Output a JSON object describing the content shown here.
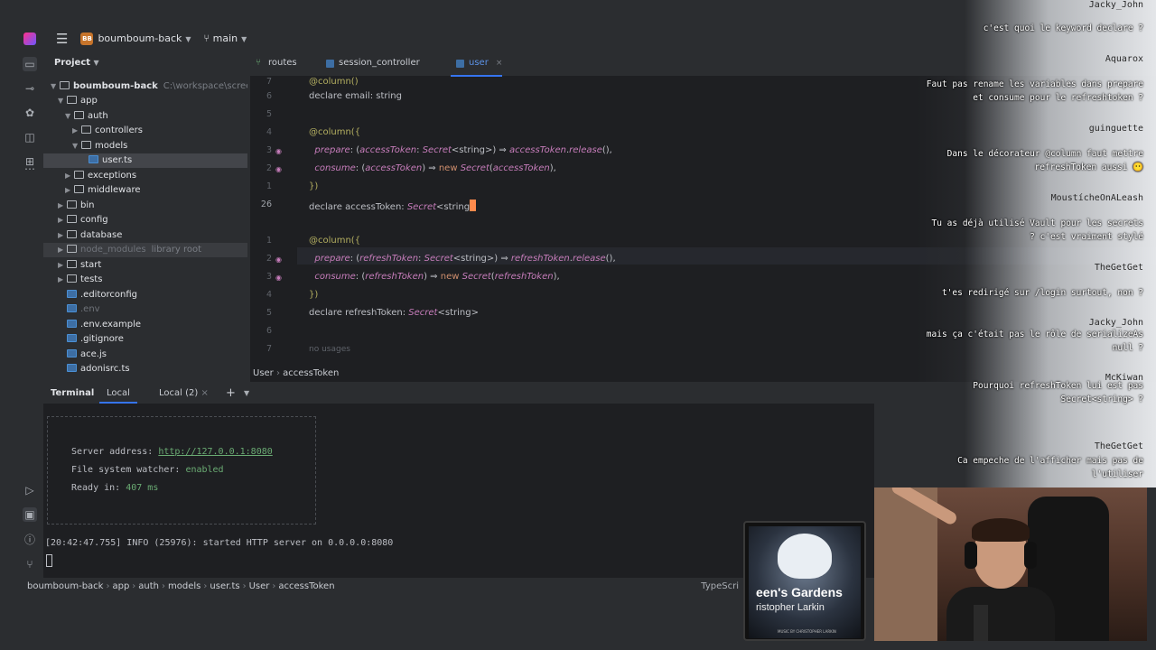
{
  "titlebar": {
    "project_badge": "BB",
    "project_name": "boumboum-back",
    "branch": "main"
  },
  "project_panel": {
    "title": "Project",
    "tree": [
      {
        "label": "boumboum-back",
        "path": "C:\\workspace\\screenca",
        "indent": 0
      },
      {
        "label": "app",
        "indent": 1
      },
      {
        "label": "auth",
        "indent": 2
      },
      {
        "label": "controllers",
        "indent": 3
      },
      {
        "label": "models",
        "indent": 3
      },
      {
        "label": "user.ts",
        "indent": 4
      },
      {
        "label": "exceptions",
        "indent": 2
      },
      {
        "label": "middleware",
        "indent": 2
      },
      {
        "label": "bin",
        "indent": 1
      },
      {
        "label": "config",
        "indent": 1
      },
      {
        "label": "database",
        "indent": 1
      },
      {
        "label": "node_modules",
        "path": "library root",
        "indent": 1
      },
      {
        "label": "start",
        "indent": 1
      },
      {
        "label": "tests",
        "indent": 1
      },
      {
        "label": ".editorconfig",
        "indent": 1
      },
      {
        "label": ".env",
        "indent": 1
      },
      {
        "label": ".env.example",
        "indent": 1
      },
      {
        "label": ".gitignore",
        "indent": 1
      },
      {
        "label": "ace.js",
        "indent": 1
      },
      {
        "label": "adonisrc.ts",
        "indent": 1
      }
    ]
  },
  "editor": {
    "tabs": [
      {
        "label": "routes"
      },
      {
        "label": "session_controller"
      },
      {
        "label": "user",
        "active": true
      }
    ],
    "close_glyph": "×",
    "line_numbers": [
      "7",
      "6",
      "5",
      "4",
      "3",
      "2",
      "1",
      "26",
      "1",
      "2",
      "3",
      "4",
      "5",
      "6",
      "7"
    ],
    "no_usages": "no usages",
    "breadcrumb": [
      "User",
      "accessToken"
    ]
  },
  "terminal": {
    "title": "Terminal",
    "tabs": [
      "Local",
      "Local (2)"
    ],
    "add_glyph": "+",
    "server_label": "Server address: ",
    "server_url": "http://127.0.0.1:8080",
    "watcher_label": "File system watcher: ",
    "watcher_value": "enabled",
    "ready_label": "Ready in: ",
    "ready_value": "407 ms",
    "log_line": "[20:42:47.755] INFO (25976): started HTTP server on 0.0.0.0:8080"
  },
  "statusbar": {
    "crumbs": [
      "boumboum-back",
      "app",
      "auth",
      "models",
      "user.ts",
      "User",
      "accessToken"
    ],
    "right": "TypeScri"
  },
  "chat": [
    {
      "name": "Jacky_John",
      "message": "c'est quoi le keyword declare ?"
    },
    {
      "name": "Aquarox",
      "message": "Faut pas rename les variables dans prepare et consume pour le refreshtoken ?"
    },
    {
      "name": "guinguette",
      "message": "Dans le décorateur @column faut mettre refreshToken aussi 😶"
    },
    {
      "name": "MoustícheOnALeash",
      "message": "Tu as déjà utilisé Vault pour les secrets ? c'est vraiment stylé"
    },
    {
      "name": "TheGetGet",
      "message": "t'es redirigé sur /login surtout, non ?"
    },
    {
      "name": "Jacky_John",
      "message": "mais ça c'était pas le rôle de serializeAs null ?"
    },
    {
      "name": "McKiwan",
      "message": "Pourquoi refreshToken lui est pas Secret<string> ?"
    },
    {
      "name": "TheGetGet",
      "message": "Ca empeche de l'afficher mais pas de l'utiliser"
    }
  ],
  "album": {
    "title": "een's Gardens",
    "artist": "ristopher Larkin",
    "credit": "MUSIC BY CHRISTOPHER LARKIN"
  }
}
